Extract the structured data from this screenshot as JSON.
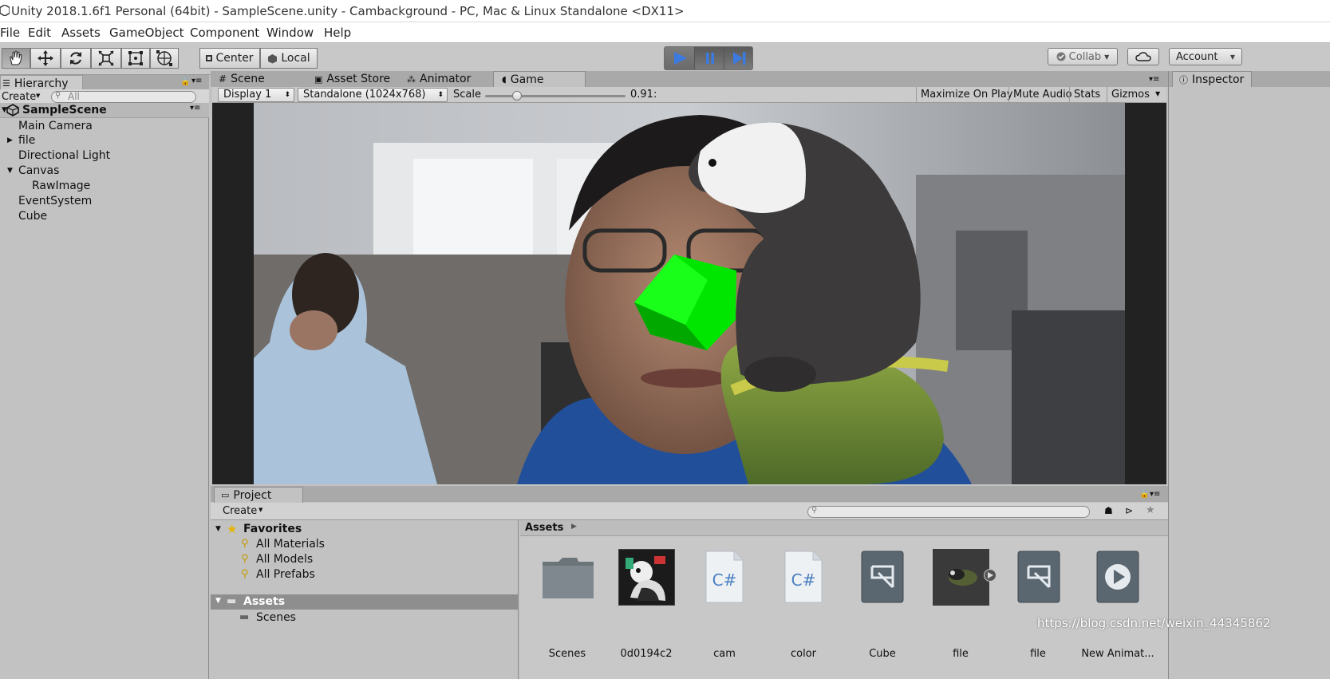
{
  "window": {
    "title": "Unity 2018.1.6f1 Personal (64bit) - SampleScene.unity - Cambackground - PC, Mac & Linux Standalone <DX11>"
  },
  "menu": [
    "File",
    "Edit",
    "Assets",
    "GameObject",
    "Component",
    "Window",
    "Help"
  ],
  "toolbar": {
    "pivot_label": "Center",
    "space_label": "Local",
    "collab_label": "Collab",
    "account_label": "Account"
  },
  "hierarchy": {
    "tab_label": "Hierarchy",
    "create_label": "Create",
    "search_placeholder": "All",
    "scene_name": "SampleScene",
    "items": [
      "Main Camera",
      "file",
      "Directional Light",
      "Canvas",
      "RawImage",
      "EventSystem",
      "Cube"
    ]
  },
  "center_tabs": [
    "Scene",
    "Asset Store",
    "Animator",
    "Game"
  ],
  "game_view": {
    "display_label": "Display 1",
    "resolution_label": "Standalone (1024x768)",
    "scale_label": "Scale",
    "scale_value": "0.91:",
    "scale_slider_fraction": 0.23,
    "buttons": [
      "Maximize On Play",
      "Mute Audio",
      "Stats",
      "Gizmos"
    ]
  },
  "inspector": {
    "tab_label": "Inspector"
  },
  "project": {
    "tab_label": "Project",
    "create_label": "Create",
    "favorites_label": "Favorites",
    "favorites": [
      "All Materials",
      "All Models",
      "All Prefabs"
    ],
    "assets_label": "Assets",
    "asset_folders": [
      "Scenes"
    ],
    "breadcrumb": "Assets",
    "assets": [
      {
        "name": "Scenes",
        "icon": "folder-icon"
      },
      {
        "name": "0d0194c2",
        "icon": "image-thumbnail-icon"
      },
      {
        "name": "cam",
        "icon": "csharp-script-icon"
      },
      {
        "name": "color",
        "icon": "csharp-script-icon"
      },
      {
        "name": "Cube",
        "icon": "prefab-icon"
      },
      {
        "name": "file",
        "icon": "model-icon"
      },
      {
        "name": "file",
        "icon": "prefab-icon"
      },
      {
        "name": "New Animat...",
        "icon": "animation-clip-icon"
      }
    ]
  },
  "watermark": "https://blog.csdn.net/weixin_44345862",
  "colors": {
    "selected_blue": "#3c7ae0",
    "cube_green": "#00e600",
    "panel_bg": "#c2c2c2"
  }
}
